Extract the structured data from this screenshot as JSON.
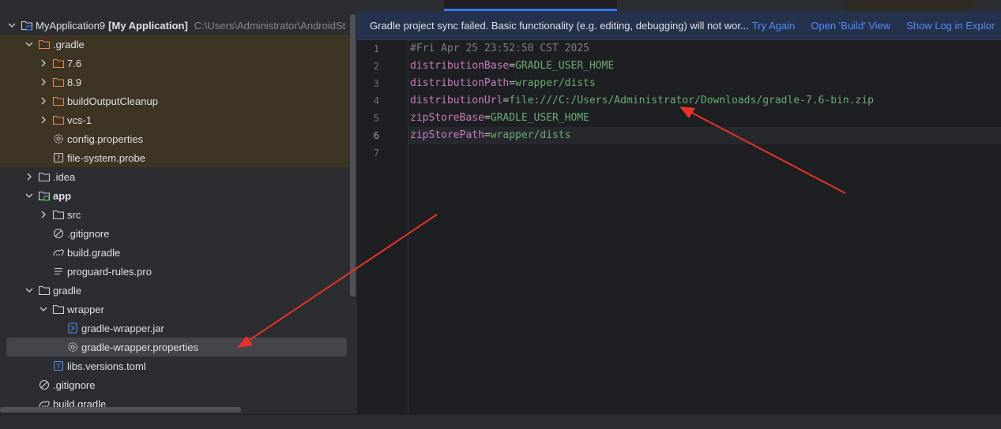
{
  "project_tree": {
    "root": {
      "name": "MyApplication9",
      "module": "[My Application]",
      "path": "C:\\Users\\Administrator\\AndroidSt"
    },
    "items": [
      {
        "label": ".gradle"
      },
      {
        "label": "7.6"
      },
      {
        "label": "8.9"
      },
      {
        "label": "buildOutputCleanup"
      },
      {
        "label": "vcs-1"
      },
      {
        "label": "config.properties"
      },
      {
        "label": "file-system.probe"
      },
      {
        "label": ".idea"
      },
      {
        "label": "app"
      },
      {
        "label": "src"
      },
      {
        "label": ".gitignore"
      },
      {
        "label": "build.gradle"
      },
      {
        "label": "proguard-rules.pro"
      },
      {
        "label": "gradle"
      },
      {
        "label": "wrapper"
      },
      {
        "label": "gradle-wrapper.jar"
      },
      {
        "label": "gradle-wrapper.properties"
      },
      {
        "label": "libs.versions.toml"
      },
      {
        "label": ".gitignore"
      },
      {
        "label": "build.gradle"
      }
    ]
  },
  "banner": {
    "message": "Gradle project sync failed. Basic functionality (e.g. editing, debugging) will not wor...",
    "actions": [
      "Try Again",
      "Open 'Build' View",
      "Show Log in Explor"
    ]
  },
  "editor": {
    "line_numbers": [
      "1",
      "2",
      "3",
      "4",
      "5",
      "6",
      "7"
    ],
    "comment": "#Fri Apr 25 23:52:50 CST 2025",
    "properties": [
      {
        "key": "distributionBase",
        "value": "GRADLE_USER_HOME"
      },
      {
        "key": "distributionPath",
        "value": "wrapper/dists"
      },
      {
        "key": "distributionUrl",
        "value": "file:///C:/Users/Administrator/Downloads/gradle-7.6-bin.zip"
      },
      {
        "key": "zipStoreBase",
        "value": "GRADLE_USER_HOME"
      },
      {
        "key": "zipStorePath",
        "value": "wrapper/dists"
      }
    ],
    "equals": "="
  },
  "colors": {
    "accent": "#3574f0",
    "banner_link": "#548af7",
    "annotation_arrow": "#e8312a",
    "property_key": "#c77dbb",
    "property_value": "#6aab73",
    "excluded_folder_highlight": "#3d3424"
  }
}
